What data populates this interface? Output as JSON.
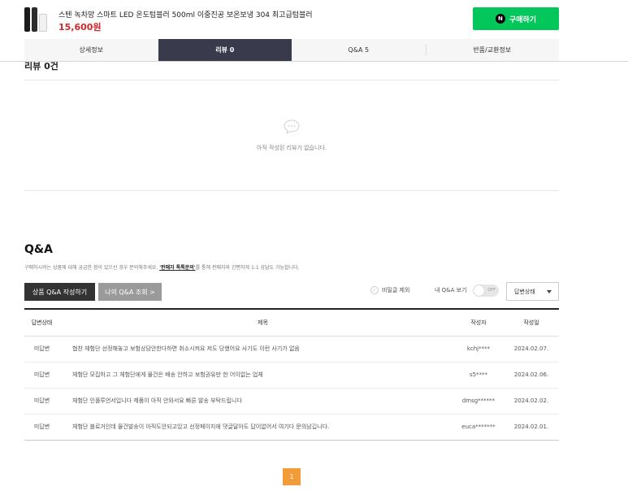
{
  "product": {
    "name": "스텐 녹차망 스마트 LED 온도텀블러 500ml 이중진공 보온보냉 304 최고급텀블러",
    "price": "15,600원",
    "buy_label": "구매하기",
    "buy_icon": "N"
  },
  "tabs": [
    {
      "label": "상세정보"
    },
    {
      "label": "리뷰 0"
    },
    {
      "label": "Q&A 5"
    },
    {
      "label": "반품/교환정보"
    }
  ],
  "review": {
    "title": "리뷰 0건",
    "empty_text": "아직 작성된 리뷰가 없습니다."
  },
  "qa": {
    "title": "Q&A",
    "desc_before": "구매하시려는 상품에 대해 궁금한 점이 있으신 경우 문의해주세요. ",
    "desc_link": "'판매자 톡톡문의'",
    "desc_after": "를 통해 판매자와 간편하게 1:1 상담도 가능합니다.",
    "write_button": "상품 Q&A 작성하기",
    "my_button": "나의 Q&A 조회 >",
    "exclude_secret": "비밀글 제외",
    "my_qa_label": "내 Q&A 보기",
    "toggle_state": "OFF",
    "status_select": "답변상태",
    "columns": {
      "status": "답변상태",
      "title": "제목",
      "author": "작성자",
      "date": "작성일"
    },
    "rows": [
      {
        "status": "미답변",
        "title": "협찬 체험단 선정해놓고 보험상담안한다하면 취소시켜요 저도 당했어요 사기도 이런 사기가 없음",
        "author": "kchj****",
        "date": "2024.02.07."
      },
      {
        "status": "미답변",
        "title": "체험단 모집하고 그 체험단에게 물건은 배송 안하고 보험권유만 한 어이없는 업체",
        "author": "s5****",
        "date": "2024.02.06."
      },
      {
        "status": "미답변",
        "title": "체험단 인플루언서입니다 제품이 아직 안와서요 빠른 발송 부탁드립니다",
        "author": "dmsg******",
        "date": "2024.02.02."
      },
      {
        "status": "미답변",
        "title": "체험단 블로거인데 물건발송이 아직도안되고있고 선정페이지에 댓글달아도 답이없어서 여기다 문의남깁니다.",
        "author": "euca*******",
        "date": "2024.02.01."
      }
    ]
  },
  "pagination": {
    "current": "1"
  }
}
